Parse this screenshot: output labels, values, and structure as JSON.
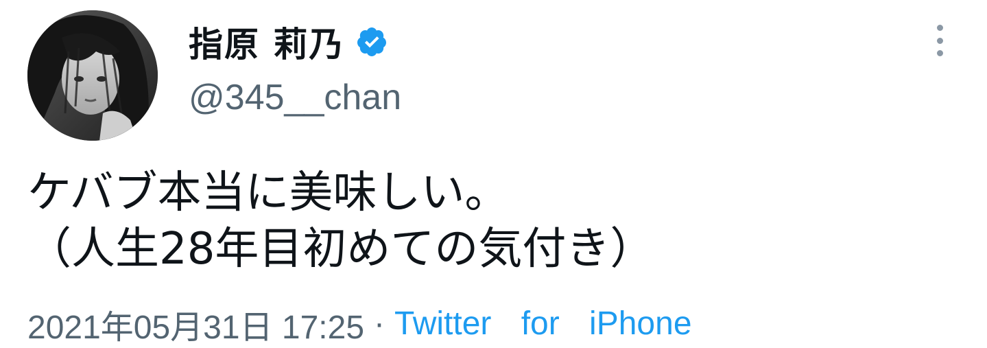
{
  "tweet": {
    "author": {
      "display_name": "指原 莉乃",
      "handle": "@345__chan",
      "verified": true
    },
    "text": "ケバブ本当に美味しい。\n（人生28年目初めての気付き）",
    "timestamp": "2021年05月31日 17:25",
    "separator": "·",
    "source": "Twitter for iPhone"
  },
  "icons": {
    "verified": "verified-badge-icon",
    "more": "more-options-icon"
  },
  "colors": {
    "accent": "#1d9bf0",
    "secondary_text": "#536471",
    "primary_text": "#0f1419",
    "icon_gray": "#8b98a5"
  }
}
